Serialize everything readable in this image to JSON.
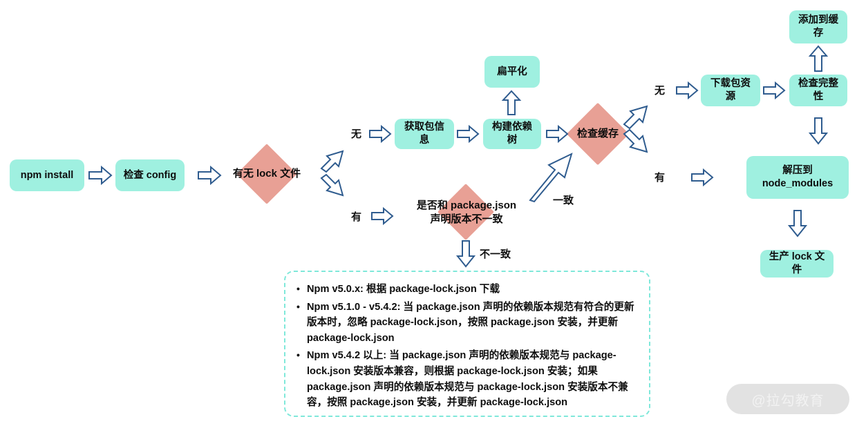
{
  "diagram": {
    "title": "npm install flowchart",
    "colors": {
      "node_fill": "#9ff0e0",
      "decision_fill": "#e8a095",
      "arrow_stroke": "#2f5c8f",
      "note_border": "#7fe8da",
      "text": "#0d0d0d",
      "watermark_pill": "#e2e2e2"
    },
    "nodes": [
      {
        "id": "npm-install",
        "label": "npm install"
      },
      {
        "id": "check-config",
        "label": "检查 config"
      },
      {
        "id": "get-package-info",
        "label": "获取包信息"
      },
      {
        "id": "build-dep-tree",
        "label": "构建依赖树"
      },
      {
        "id": "flatten",
        "label": "扁平化"
      },
      {
        "id": "download-package",
        "label": "下载包资源"
      },
      {
        "id": "check-integrity",
        "label": "检查完整性"
      },
      {
        "id": "add-to-cache",
        "label": "添加到缓存"
      },
      {
        "id": "extract-node-modules",
        "label": "解压到 node_modules"
      },
      {
        "id": "generate-lock",
        "label": "生产 lock 文件"
      }
    ],
    "decisions": [
      {
        "id": "has-lock-file",
        "label": "有无 lock 文件"
      },
      {
        "id": "check-cache",
        "label": "检查缓存"
      },
      {
        "id": "version-mismatch",
        "line1": "是否和 package.json",
        "line2": "声明版本不一致"
      }
    ],
    "edge_labels": [
      {
        "id": "lock-none",
        "text": "无"
      },
      {
        "id": "lock-has",
        "text": "有"
      },
      {
        "id": "cache-none",
        "text": "无"
      },
      {
        "id": "cache-has",
        "text": "有"
      },
      {
        "id": "version-match",
        "text": "一致"
      },
      {
        "id": "version-nomatch",
        "text": "不一致"
      }
    ],
    "note": {
      "bullets": [
        "Npm v5.0.x: 根据 package-lock.json 下载",
        "Npm v5.1.0 - v5.4.2: 当 package.json 声明的依赖版本规范有符合的更新版本时，忽略 package-lock.json，按照 package.json 安装，并更新 package-lock.json",
        "Npm v5.4.2 以上: 当 package.json 声明的依赖版本规范与 package-lock.json 安装版本兼容，则根据 package-lock.json 安装；如果 package.json 声明的依赖版本规范与 package-lock.json 安装版本不兼容，按照 package.json 安装，并更新 package-lock.json"
      ]
    },
    "watermark": {
      "text": "@拉勾教育"
    }
  }
}
